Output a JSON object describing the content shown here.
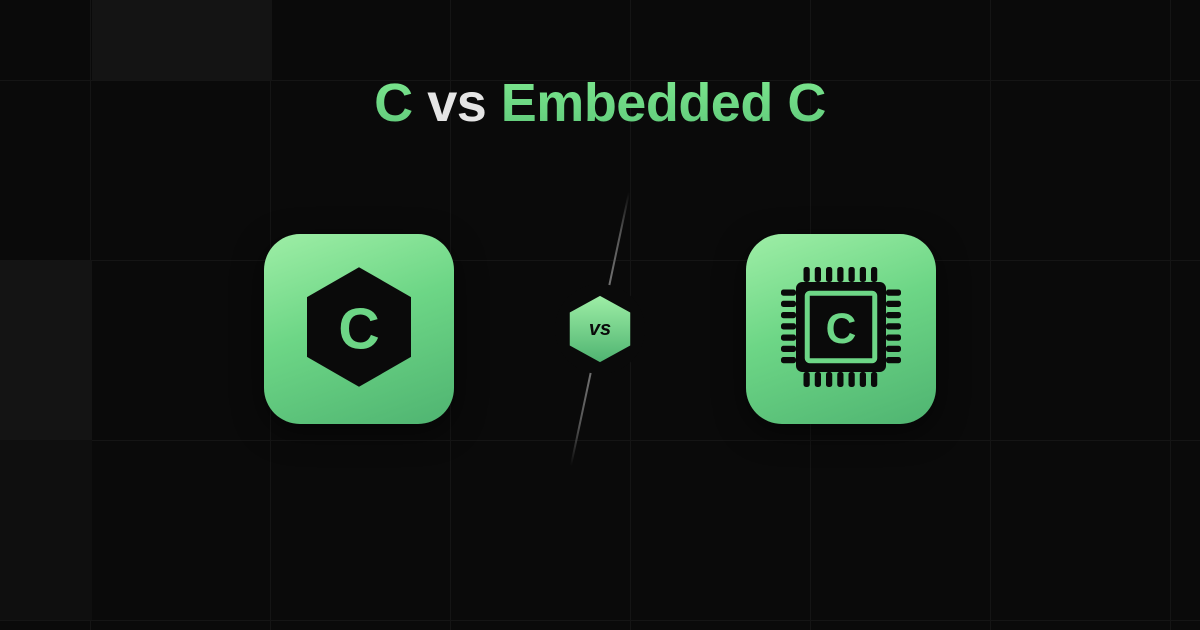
{
  "title": {
    "left": "C",
    "connector": "vs",
    "right": "Embedded C"
  },
  "left_card": {
    "letter": "C",
    "icon_name": "c-language-icon"
  },
  "center": {
    "badge_label": "vs"
  },
  "right_card": {
    "letter": "C",
    "icon_name": "chip-icon"
  },
  "colors": {
    "accent_gradient_top": "#9eeea6",
    "accent_gradient_bottom": "#4fb471",
    "background": "#0a0a0a"
  }
}
